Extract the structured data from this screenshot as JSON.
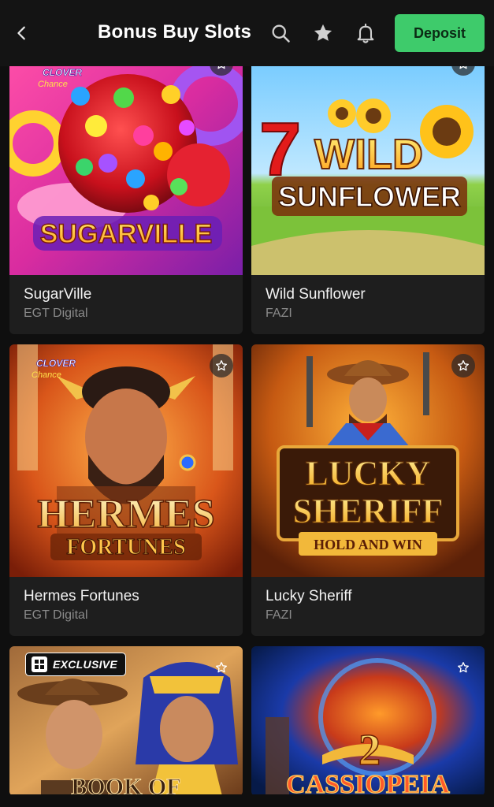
{
  "header": {
    "title": "Bonus Buy Slots",
    "deposit_label": "Deposit"
  },
  "games": [
    {
      "name": "SugarVille",
      "provider": "EGT Digital",
      "art_title": "SUGARVILLE",
      "art_brand": "CLOVER Chance"
    },
    {
      "name": "Wild Sunflower",
      "provider": "FAZI",
      "art_title_1": "WILD",
      "art_title_2": "SUNFLOWER",
      "art_number": "7"
    },
    {
      "name": "Hermes Fortunes",
      "provider": "EGT Digital",
      "art_title_1": "HERMES",
      "art_title_2": "FORTUNES",
      "art_brand": "CLOVER Chance"
    },
    {
      "name": "Lucky Sheriff",
      "provider": "FAZI",
      "art_title_1": "LUCKY",
      "art_title_2": "SHERIFF",
      "art_tagline": "HOLD AND WIN"
    },
    {
      "badge": "EXCLUSIVE",
      "art_title": "BOOK OF"
    },
    {
      "art_number": "2",
      "art_title": "CASSIOPEIA"
    }
  ],
  "colors": {
    "background": "#0f0f0f",
    "card": "#1e1e1e",
    "accent": "#3ecb6b",
    "provider_text": "#8a8a8a"
  },
  "icons": [
    "back-icon",
    "search-icon",
    "star-icon",
    "bell-icon",
    "favorite-star-icon"
  ]
}
